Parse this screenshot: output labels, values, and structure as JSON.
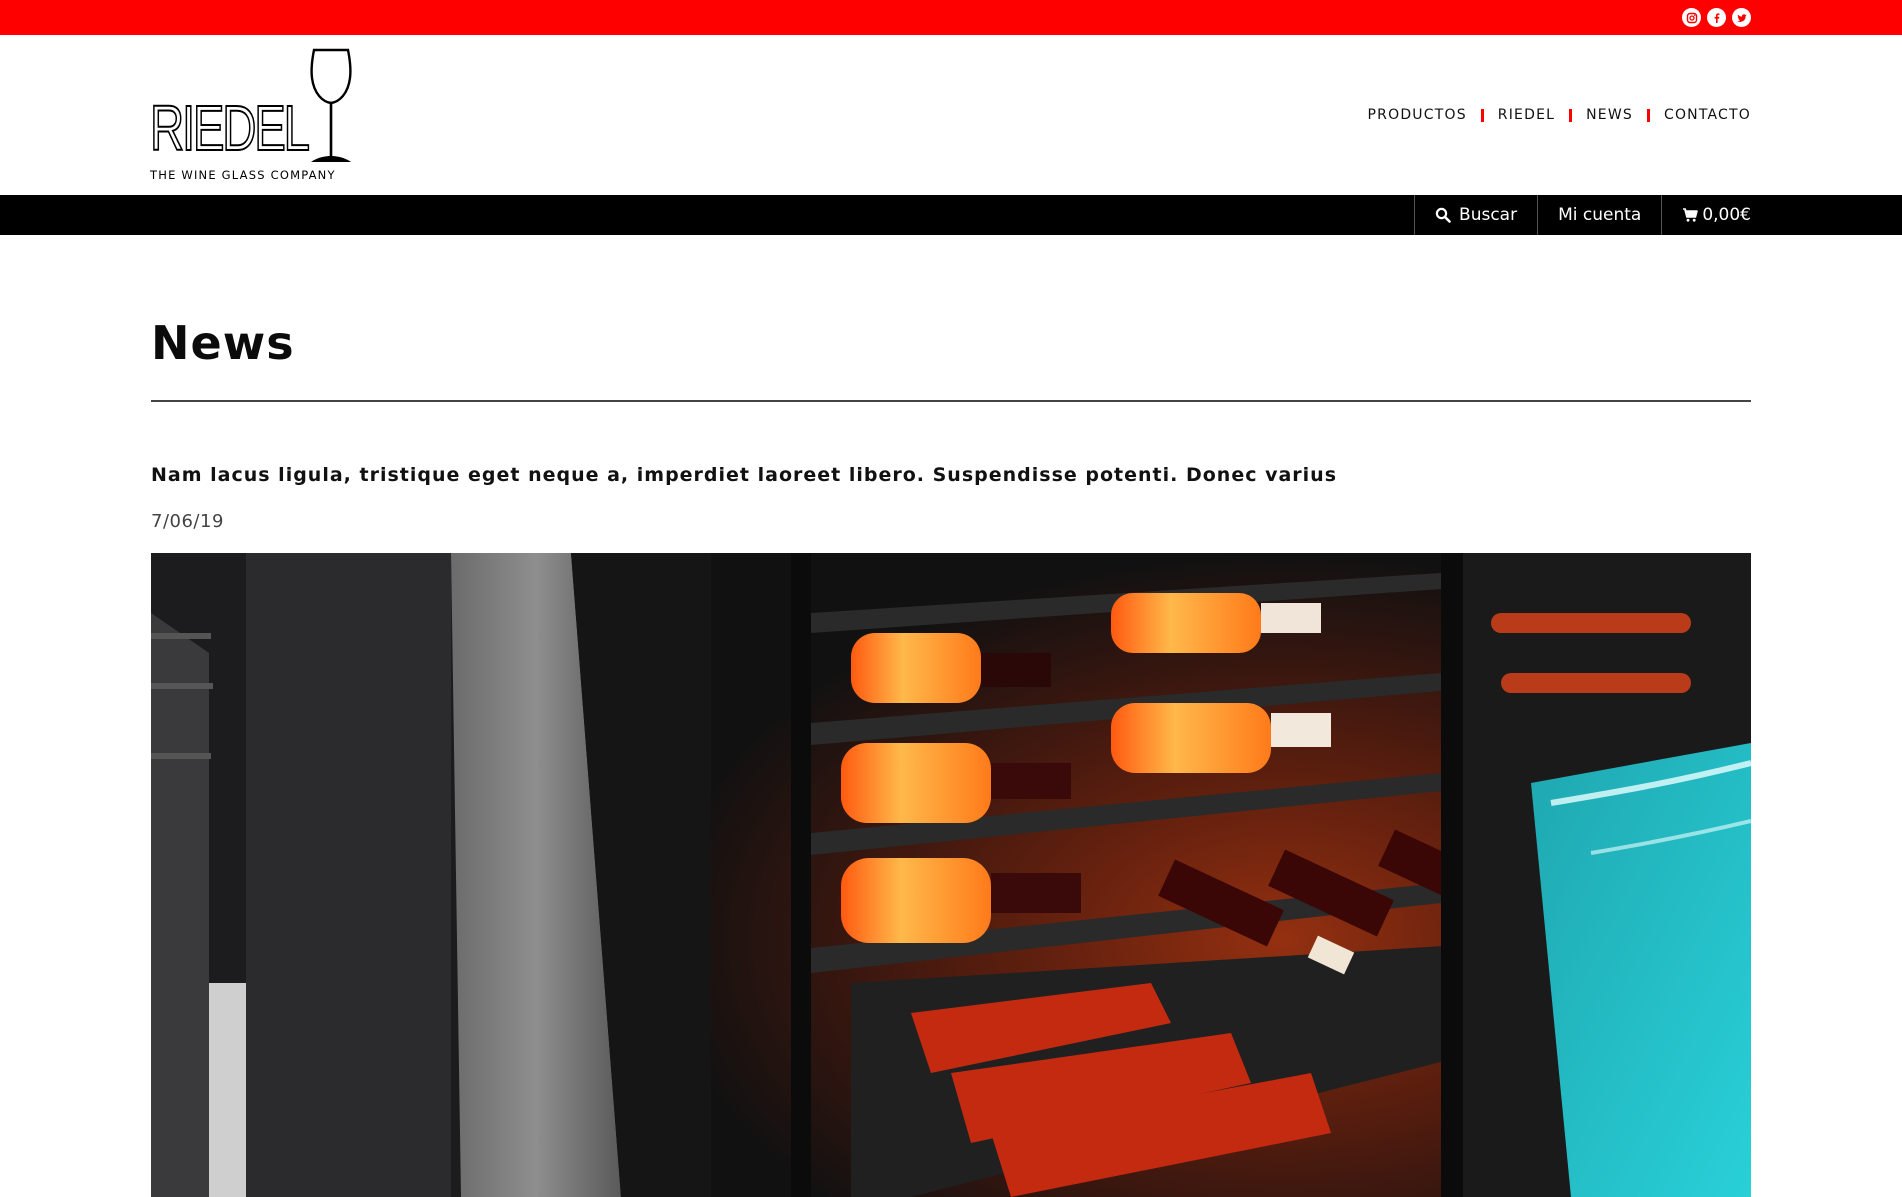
{
  "social": {
    "icons": [
      "instagram-icon",
      "facebook-icon",
      "twitter-icon"
    ]
  },
  "brand": {
    "wordmark": "RIEDEL",
    "tagline": "THE WINE GLASS COMPANY"
  },
  "nav": {
    "items": [
      {
        "label": "PRODUCTOS"
      },
      {
        "label": "RIEDEL"
      },
      {
        "label": "NEWS"
      },
      {
        "label": "CONTACTO"
      }
    ]
  },
  "utility": {
    "search_label": "Buscar",
    "account_label": "Mi cuenta",
    "cart_total": "0,00€"
  },
  "page": {
    "title": "News"
  },
  "post": {
    "title": "Nam lacus ligula, tristique eget neque a, imperdiet laoreet libero. Suspendisse potenti. Donec varius",
    "date": "7/06/19"
  },
  "colors": {
    "accent": "#fe0000",
    "bar": "#000000"
  }
}
